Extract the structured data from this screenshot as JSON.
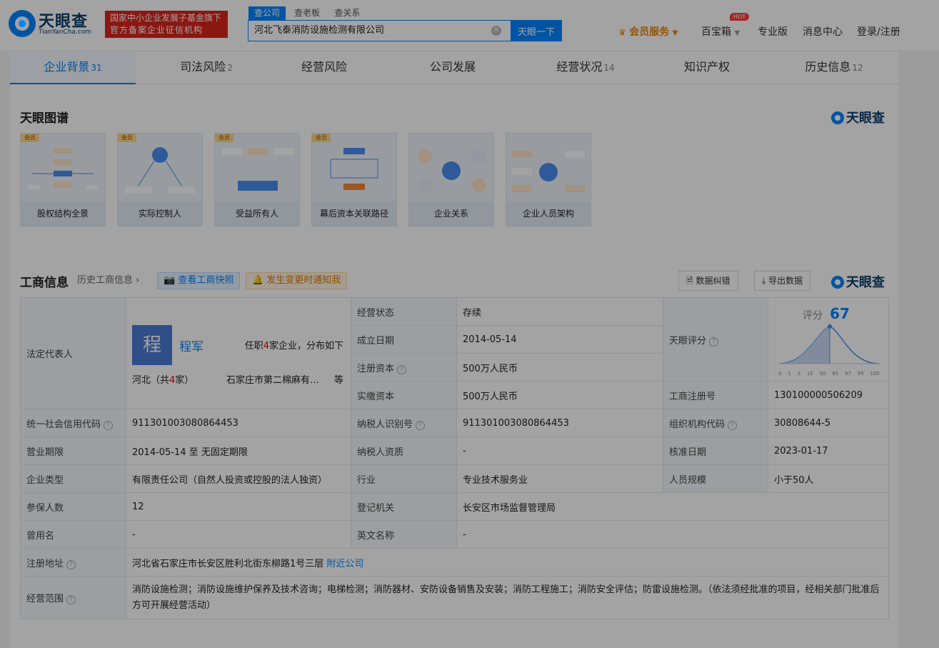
{
  "header": {
    "logo_text": "天眼查",
    "logo_sub": "TianYanCha.com",
    "badge_line1": "国家中小企业发展子基金旗下",
    "badge_line2": "官方备案企业征信机构",
    "search_tabs": [
      "查公司",
      "查老板",
      "查关系"
    ],
    "search_value": "河北飞泰消防设施检测有限公司",
    "search_button": "天眼一下",
    "nav": {
      "vip": "会员服务",
      "toolbox": "百宝箱",
      "hot": "HOT",
      "pro": "专业版",
      "messages": "消息中心",
      "login": "登录/注册"
    }
  },
  "tabs": [
    {
      "label": "企业背景",
      "count": "31"
    },
    {
      "label": "司法风险",
      "count": "2"
    },
    {
      "label": "经营风险",
      "count": ""
    },
    {
      "label": "公司发展",
      "count": ""
    },
    {
      "label": "经营状况",
      "count": "14"
    },
    {
      "label": "知识产权",
      "count": ""
    },
    {
      "label": "历史信息",
      "count": "12"
    }
  ],
  "graph": {
    "title": "天眼图谱",
    "brand": "天眼查",
    "vip_badge": "会员",
    "cards": [
      {
        "label": "股权结构全景"
      },
      {
        "label": "实际控制人"
      },
      {
        "label": "受益所有人"
      },
      {
        "label": "幕后资本关联路径"
      },
      {
        "label": "企业关系"
      },
      {
        "label": "企业人员架构"
      }
    ]
  },
  "biz": {
    "title": "工商信息",
    "history": "历史工商信息",
    "snapshot_btn": "查看工商快照",
    "notify_btn": "发生变更时通知我",
    "error_btn": "数据纠错",
    "export_btn": "导出数据",
    "brand": "天眼查"
  },
  "legal": {
    "label": "法定代表人",
    "avatar_char": "程",
    "name": "程军",
    "roles_pre": "任职",
    "roles_count": "4",
    "roles_post": "家企业，分布如下",
    "region_pre": "河北（共",
    "region_count": "4",
    "region_post": "家）",
    "company": "石家庄市第二棉麻有…",
    "etc": "等"
  },
  "score": {
    "label": "天眼评分",
    "title": "评分",
    "value": "67",
    "axis": [
      "0",
      "1",
      "3",
      "15",
      "50",
      "85",
      "97",
      "99",
      "100"
    ]
  },
  "rows": {
    "status_k": "经营状态",
    "status_v": "存续",
    "founded_k": "成立日期",
    "founded_v": "2014-05-14",
    "capital_k": "注册资本",
    "capital_v": "500万人民币",
    "paid_k": "实缴资本",
    "paid_v": "500万人民币",
    "regno_k": "工商注册号",
    "regno_v": "130100000506209",
    "credit_k": "统一社会信用代码",
    "credit_v": "911301003080864453",
    "taxid_k": "纳税人识别号",
    "taxid_v": "911301003080864453",
    "org_k": "组织机构代码",
    "org_v": "30808644-5",
    "term_k": "营业期限",
    "term_from": "2014-05-14",
    "term_sep": "至",
    "term_to": "无固定期限",
    "taxq_k": "纳税人资质",
    "taxq_v": "-",
    "approve_k": "核准日期",
    "approve_v": "2023-01-17",
    "type_k": "企业类型",
    "type_v": "有限责任公司（自然人投资或控股的法人独资）",
    "industry_k": "行业",
    "industry_v": "专业技术服务业",
    "size_k": "人员规模",
    "size_v": "小于50人",
    "insured_k": "参保人数",
    "insured_v": "12",
    "authority_k": "登记机关",
    "authority_v": "长安区市场监督管理局",
    "former_k": "曾用名",
    "former_v": "-",
    "en_k": "英文名称",
    "en_v": "-",
    "addr_k": "注册地址",
    "addr_v": "河北省石家庄市长安区胜利北街东柳路1号三层",
    "addr_link": "附近公司",
    "scope_k": "经营范围",
    "scope_v": "消防设施检测；消防设施维护保养及技术咨询；电梯检测；消防器材、安防设备销售及安装；消防工程施工；消防安全评估；防雷设施检测。（依法须经批准的项目，经相关部门批准后方可开展经营活动）"
  }
}
